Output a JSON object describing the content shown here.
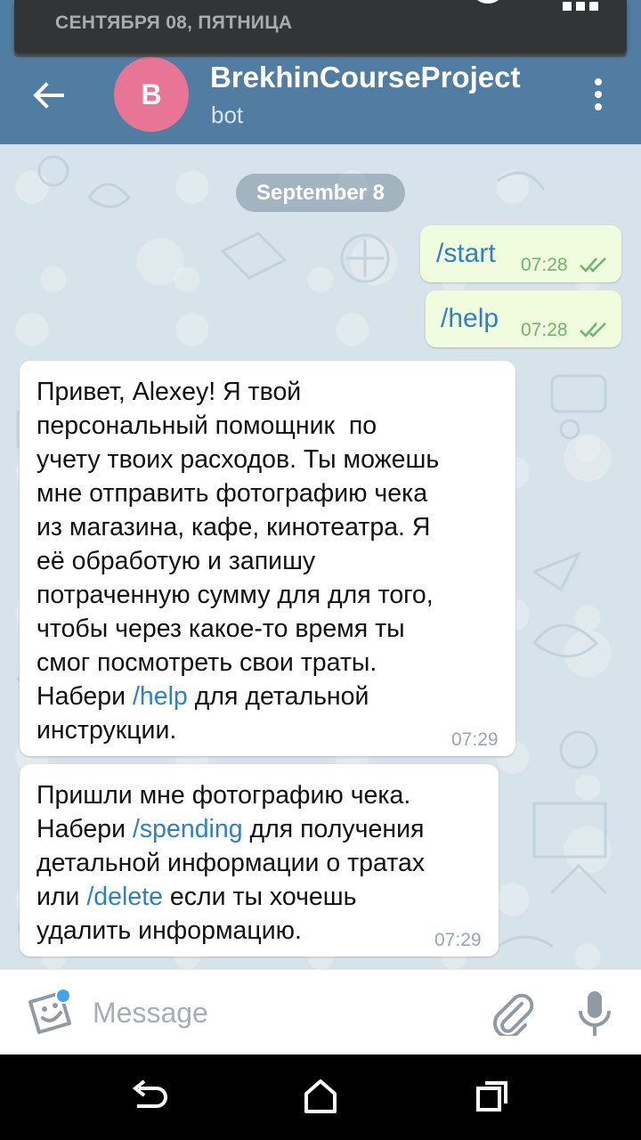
{
  "notification": {
    "date_text": "СЕНТЯБРЯ 08, ПЯТНИЦА"
  },
  "header": {
    "avatar_letter": "B",
    "title": "BrekhinCourseProject",
    "subtitle": "bot",
    "back_icon": "arrow-left-icon",
    "menu_icon": "vertical-dots-icon"
  },
  "date_separator": "September 8",
  "messages": [
    {
      "direction": "outgoing",
      "text": "/start",
      "time": "07:28",
      "status": "read-double-check"
    },
    {
      "direction": "outgoing",
      "text": "/help",
      "time": "07:28",
      "status": "read-double-check"
    },
    {
      "direction": "incoming",
      "time": "07:29",
      "lines": [
        "Привет, Alexey! Я твой",
        "персональный помощник  по",
        "учету твоих расходов. Ты можешь",
        "мне отправить фотографию чека",
        "из магазина, кафе, кинотеатра. Я",
        "её обработую и запишу",
        "потраченную сумму для для того,",
        "чтобы через какое-то время ты",
        "смог посмотреть свои траты."
      ],
      "line10_before": "Набери ",
      "line10_link": "/help",
      "line10_after": " для детальной",
      "line11": "инструкции."
    },
    {
      "direction": "incoming",
      "time": "07:29",
      "line1": "Пришли мне фотографию чека.",
      "line2_before": "Набери ",
      "line2_link": "/spending",
      "line2_after": " для получения",
      "line3": "детальной информации о тратах",
      "line4_before": "или ",
      "line4_link": "/delete",
      "line4_after": " если ты хочешь",
      "line5": "удалить информацию."
    }
  ],
  "composer": {
    "placeholder": "Message",
    "sticker_icon": "sticker-icon",
    "attach_icon": "paperclip-icon",
    "mic_icon": "microphone-icon"
  },
  "system_nav": {
    "back_icon": "nav-back-icon",
    "home_icon": "nav-home-icon",
    "recents_icon": "nav-recents-icon"
  },
  "colors": {
    "header": "#527da3",
    "avatar": "#e87595",
    "outgoing_bubble": "#effdde",
    "incoming_bubble": "#ffffff",
    "link": "#2f80c3",
    "read_check": "#6db56d"
  }
}
